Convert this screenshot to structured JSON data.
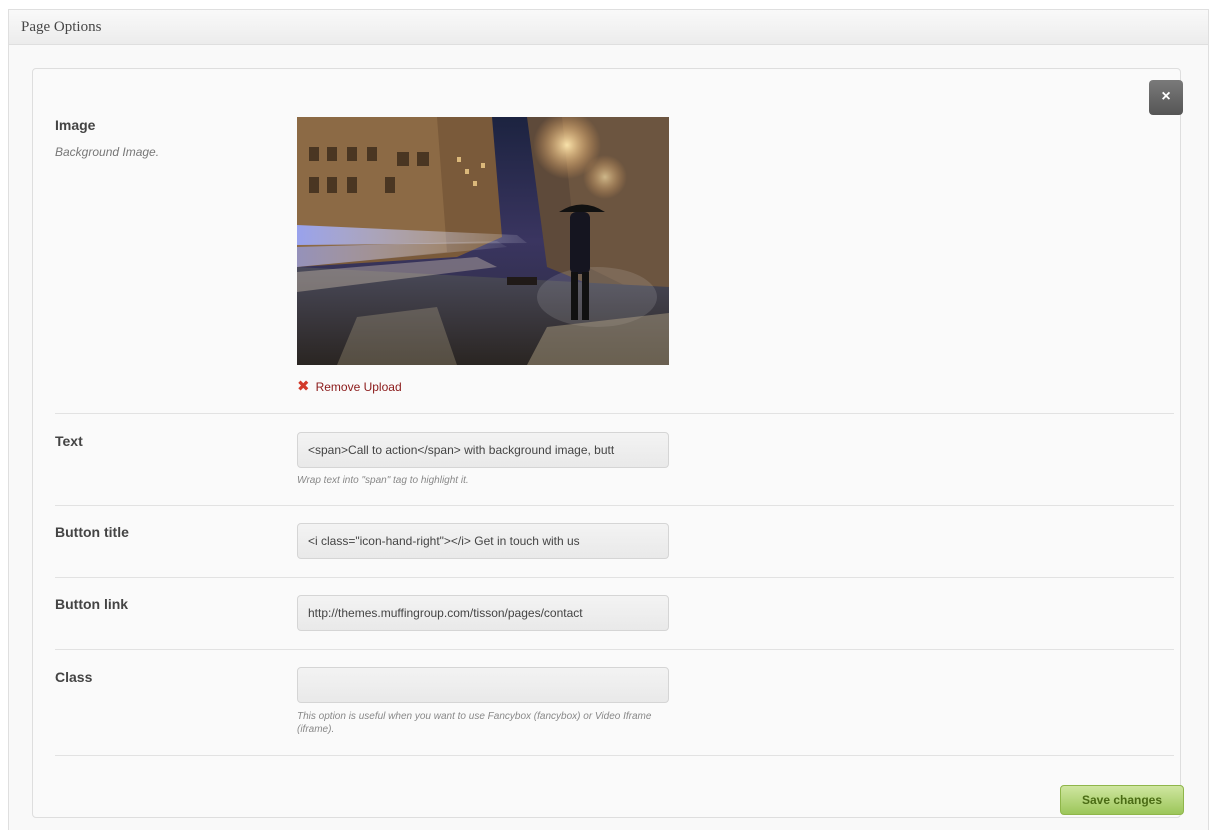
{
  "metabox": {
    "title": "Page Options"
  },
  "panel": {
    "close_label": "×",
    "image": {
      "label": "Image",
      "description": "Background Image.",
      "remove_label": "Remove Upload"
    },
    "text": {
      "label": "Text",
      "value": "<span>Call to action</span> with background image, butt",
      "hint": "Wrap text into \"span\" tag to highlight it."
    },
    "button_title": {
      "label": "Button title",
      "value": "<i class=\"icon-hand-right\"></i> Get in touch with us"
    },
    "button_link": {
      "label": "Button link",
      "value": "http://themes.muffingroup.com/tisson/pages/contact"
    },
    "class_field": {
      "label": "Class",
      "value": "",
      "hint": "This option is useful when you want to use Fancybox (fancybox) or Video Iframe (iframe)."
    },
    "save_label": "Save changes"
  },
  "colors": {
    "save_button": "#9cc65a",
    "close_button": "#555555",
    "remove_link": "#8b1a1a"
  }
}
